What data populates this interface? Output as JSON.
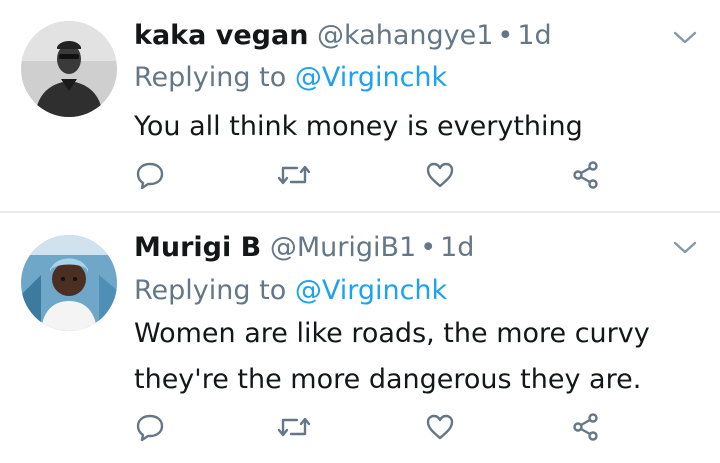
{
  "tweets": [
    {
      "display_name": "kaka vegan",
      "handle": "@kahangye1",
      "separator": "•",
      "time": "1d",
      "reply_prefix": "Replying to",
      "reply_to": "@Virginchk",
      "lines": [
        "You all think money is everything"
      ]
    },
    {
      "display_name": "Murigi B",
      "handle": "@MurigiB1",
      "separator": "•",
      "time": "1d",
      "reply_prefix": "Replying to",
      "reply_to": "@Virginchk",
      "lines": [
        "Women are like roads, the more curvy",
        "they're the more dangerous they are."
      ]
    }
  ],
  "icons": {
    "reply": "reply-icon",
    "retweet": "retweet-icon",
    "like": "heart-icon",
    "share": "share-icon",
    "menu": "chevron-down-icon"
  },
  "colors": {
    "text": "#14171a",
    "secondary": "#657786",
    "link": "#1da1f2",
    "divider": "#e6ecf0"
  }
}
